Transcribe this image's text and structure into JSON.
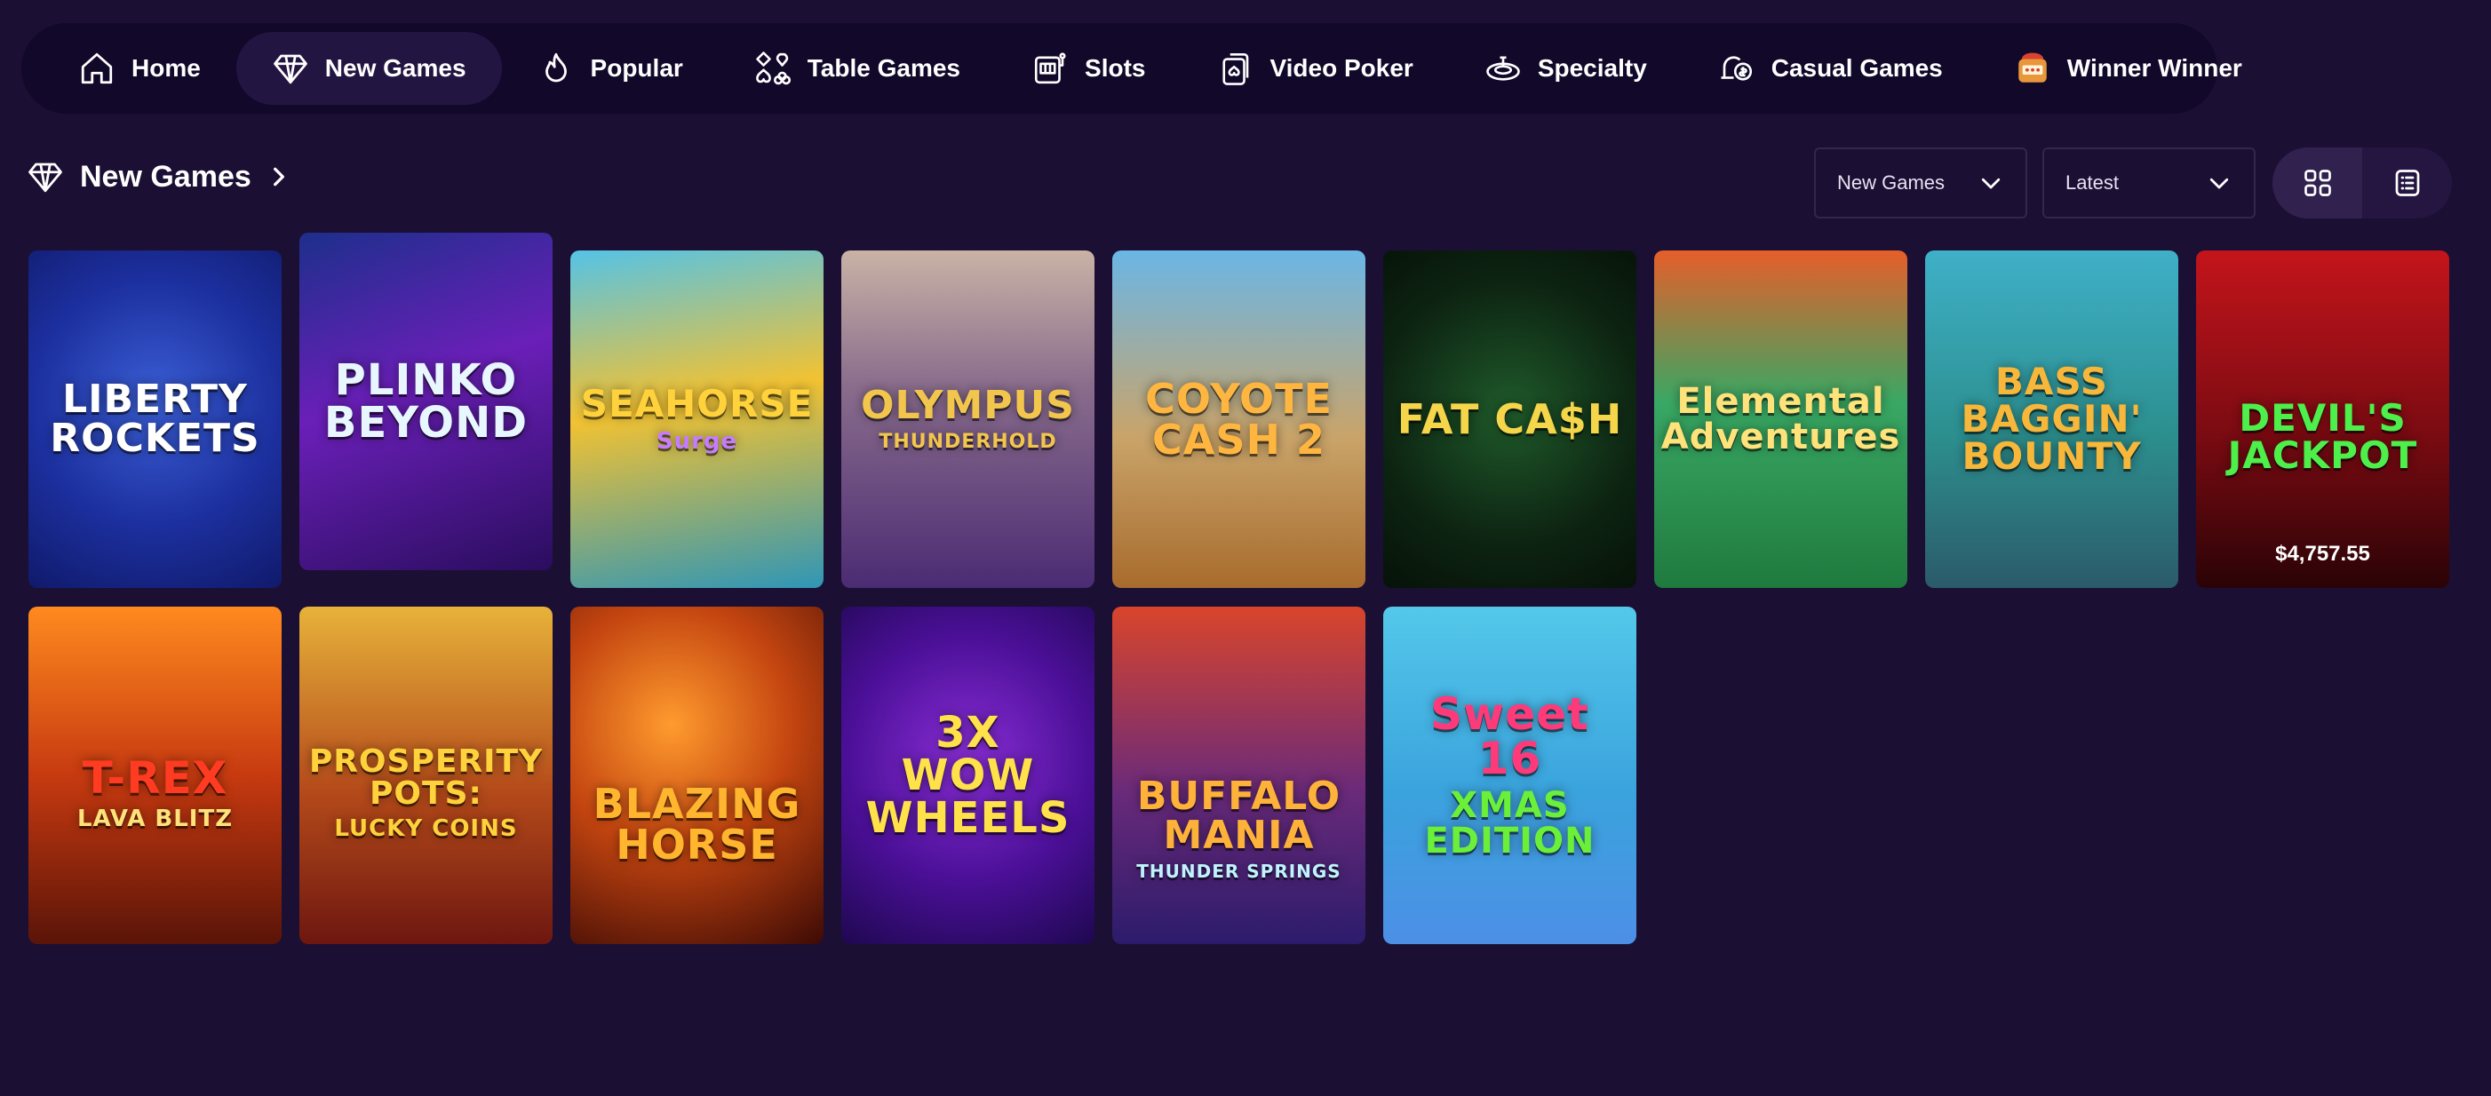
{
  "nav": {
    "items": [
      {
        "label": "Home",
        "icon": "home-icon"
      },
      {
        "label": "New Games",
        "icon": "diamond-icon",
        "active": true
      },
      {
        "label": "Popular",
        "icon": "flame-icon"
      },
      {
        "label": "Table Games",
        "icon": "card-suits-icon"
      },
      {
        "label": "Slots",
        "icon": "slot-machine-icon"
      },
      {
        "label": "Video Poker",
        "icon": "poker-card-icon"
      },
      {
        "label": "Specialty",
        "icon": "roulette-icon"
      },
      {
        "label": "Casual Games",
        "icon": "bell-coin-icon"
      },
      {
        "label": "Winner Winner",
        "icon": "jackpot-icon"
      }
    ]
  },
  "section": {
    "title": "New Games",
    "icon": "diamond-icon"
  },
  "filters": {
    "category": "New Games",
    "sort": "Latest",
    "view": "grid"
  },
  "games": [
    {
      "title": "LIBERTY\nROCKETS",
      "jackpot": null
    },
    {
      "title": "PLINKO\nBEYOND",
      "jackpot": null
    },
    {
      "title": "SEAHORSE",
      "subtitle": "Surge",
      "jackpot": null
    },
    {
      "title": "OLYMPUS",
      "subtitle": "THUNDERHOLD",
      "jackpot": null
    },
    {
      "title": "COYOTE\nCASH 2",
      "jackpot": null
    },
    {
      "title": "FAT CA$H",
      "jackpot": null
    },
    {
      "title": "Elemental\nAdventures",
      "jackpot": null
    },
    {
      "title": "BASS\nBAGGIN'\nBOUNTY",
      "jackpot": null
    },
    {
      "title": "DEVIL'S\nJACKPOT",
      "jackpot": "$4,757.55"
    },
    {
      "title": "T-REX",
      "subtitle": "LAVA BLITZ",
      "jackpot": null
    },
    {
      "title": "PROSPERITY\nPOTS:",
      "subtitle": "LUCKY COINS",
      "jackpot": null
    },
    {
      "title": "BLAZING\nHORSE",
      "jackpot": null
    },
    {
      "title": "3x\nWOW\nWHEELS",
      "jackpot": null
    },
    {
      "title": "BUFFALO\nMANIA",
      "subtitle": "THUNDER SPRINGS",
      "jackpot": null
    },
    {
      "title": "Sweet 16",
      "subtitle": "XMAS EDITION",
      "jackpot": null
    }
  ],
  "colors": {
    "background": "#1b0f33",
    "nav_bg": "#120829",
    "active_pill": "#231542"
  }
}
